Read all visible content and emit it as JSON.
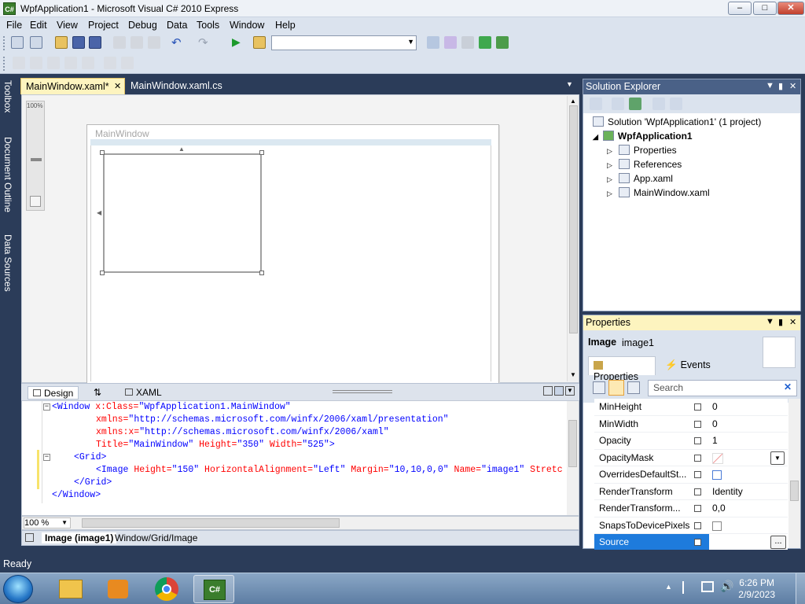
{
  "window": {
    "title": "WpfApplication1 - Microsoft Visual C# 2010 Express",
    "app_icon": "C#",
    "min": "–",
    "max": "□",
    "close": "✕"
  },
  "menu": [
    "File",
    "Edit",
    "View",
    "Project",
    "Debug",
    "Data",
    "Tools",
    "Window",
    "Help"
  ],
  "left_tool_tabs": [
    "Toolbox",
    "Document Outline",
    "Data Sources"
  ],
  "doc_tabs": {
    "active": "MainWindow.xaml*",
    "inactive": "MainWindow.xaml.cs"
  },
  "designer": {
    "zoom_label": "100%",
    "window_title": "MainWindow"
  },
  "split_tabs": {
    "design": "Design",
    "swap": "⇅",
    "xaml": "XAML"
  },
  "xaml": {
    "l1a": "<Window ",
    "l1b": "x:Class=",
    "l1c": "\"WpfApplication1.MainWindow\"",
    "l2a": "xmlns=",
    "l2b": "\"http://schemas.microsoft.com/winfx/2006/xaml/presentation\"",
    "l3a": "xmlns:x=",
    "l3b": "\"http://schemas.microsoft.com/winfx/2006/xaml\"",
    "l4a": "Title=",
    "l4b": "\"MainWindow\"",
    "l4c": " Height=",
    "l4d": "\"350\"",
    "l4e": " Width=",
    "l4f": "\"525\"",
    "l4g": ">",
    "l5a": "<Grid>",
    "l6a": "<Image ",
    "l6b": "Height=",
    "l6c": "\"150\"",
    "l6d": " HorizontalAlignment=",
    "l6e": "\"Left\"",
    "l6f": " Margin=",
    "l6g": "\"10,10,0,0\"",
    "l6h": " Name=",
    "l6i": "\"image1\"",
    "l6j": " Stretc",
    "l7a": "</Grid>",
    "l8a": "</Window>"
  },
  "editor_zoom": "100 %",
  "breadcrumb": {
    "element": "Image (image1)",
    "path": "Window/Grid/Image"
  },
  "solution_explorer": {
    "title": "Solution Explorer",
    "solution": "Solution 'WpfApplication1' (1 project)",
    "project": "WpfApplication1",
    "items": [
      "Properties",
      "References",
      "App.xaml",
      "MainWindow.xaml"
    ]
  },
  "properties": {
    "title": "Properties",
    "type": "Image",
    "name": "image1",
    "tab_properties": "Properties",
    "tab_events": "Events",
    "search_placeholder": "Search",
    "rows": [
      {
        "name": "MinHeight",
        "value": "0"
      },
      {
        "name": "MinWidth",
        "value": "0"
      },
      {
        "name": "Opacity",
        "value": "1"
      },
      {
        "name": "OpacityMask",
        "value": ""
      },
      {
        "name": "OverridesDefaultSt...",
        "value": ""
      },
      {
        "name": "RenderTransform",
        "value": "Identity"
      },
      {
        "name": "RenderTransform...",
        "value": "0,0"
      },
      {
        "name": "SnapsToDevicePixels",
        "value": ""
      },
      {
        "name": "Source",
        "value": ""
      }
    ],
    "ellipsis": "..."
  },
  "status": "Ready",
  "clock": {
    "time": "6:26 PM",
    "date": "2/9/2023"
  }
}
